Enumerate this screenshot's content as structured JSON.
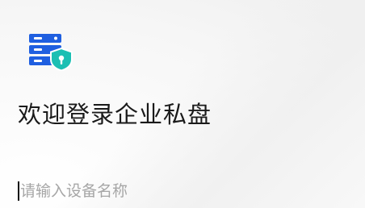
{
  "page": {
    "title": "欢迎登录企业私盘"
  },
  "logo": {
    "icon": "server-shield-icon",
    "colors": {
      "server": "#1f5fe0",
      "shield": "#1bbfb3"
    }
  },
  "device_input": {
    "value": "",
    "placeholder": "请输入设备名称"
  }
}
